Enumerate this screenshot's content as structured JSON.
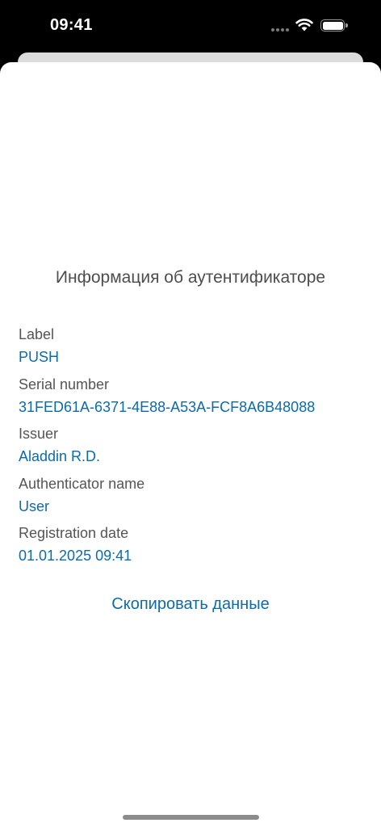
{
  "status_bar": {
    "time": "09:41"
  },
  "sheet": {
    "title": "Информация об аутентификаторе",
    "fields": [
      {
        "label": "Label",
        "value": "PUSH"
      },
      {
        "label": "Serial number",
        "value": "31FED61A-6371-4E88-A53A-FCF8A6B48088"
      },
      {
        "label": "Issuer",
        "value": "Aladdin R.D."
      },
      {
        "label": "Authenticator name",
        "value": "User"
      },
      {
        "label": "Registration date",
        "value": "01.01.2025 09:41"
      }
    ],
    "copy_button_label": "Скопировать данные"
  },
  "colors": {
    "accent": "#0B6BAB",
    "label_text": "#555555",
    "title_text": "#4D4D4D",
    "sheet_background": "#FFFFFF",
    "status_bar_background": "#000000"
  },
  "icons": [
    "signal-icon",
    "wifi-icon",
    "battery-icon"
  ]
}
